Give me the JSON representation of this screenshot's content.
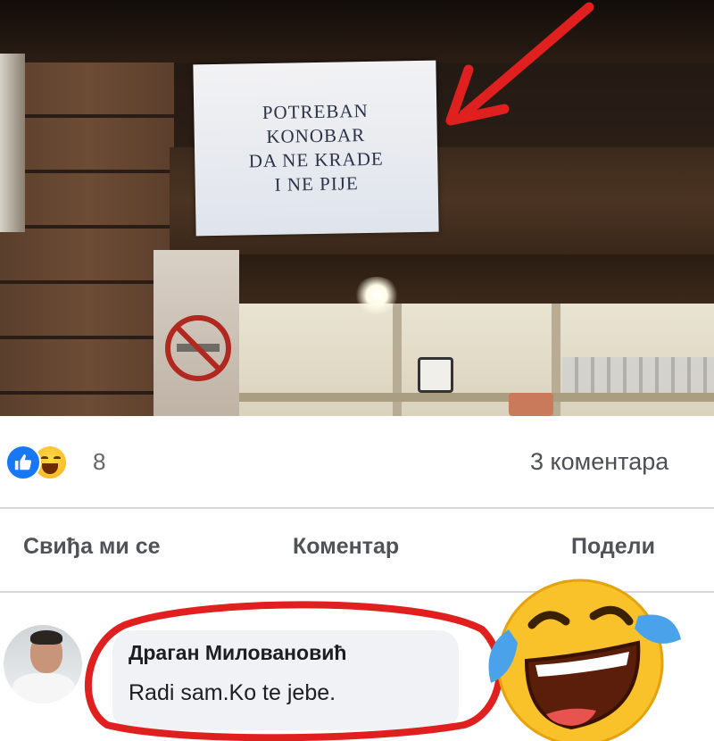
{
  "photo": {
    "sign_lines": [
      "POTREBAN",
      "KONOBAR",
      "DA NE KRADE",
      "I NE PIJE"
    ],
    "annotation_color": "#e0201f"
  },
  "reactions": {
    "icons": [
      "like-icon",
      "haha-icon"
    ],
    "count": "8",
    "comments_label": "3 коментара"
  },
  "actions": {
    "like_label": "Свиђа ми се",
    "comment_label": "Коментар",
    "share_label": "Подели"
  },
  "comment": {
    "author": "Драган Миловановић",
    "text": "Radi sam.Ko te jebe."
  },
  "colors": {
    "facebook_blue": "#1877f2",
    "bubble_bg": "#f0f2f5",
    "divider": "#d6d7da",
    "highlight_red": "#e0201f"
  }
}
